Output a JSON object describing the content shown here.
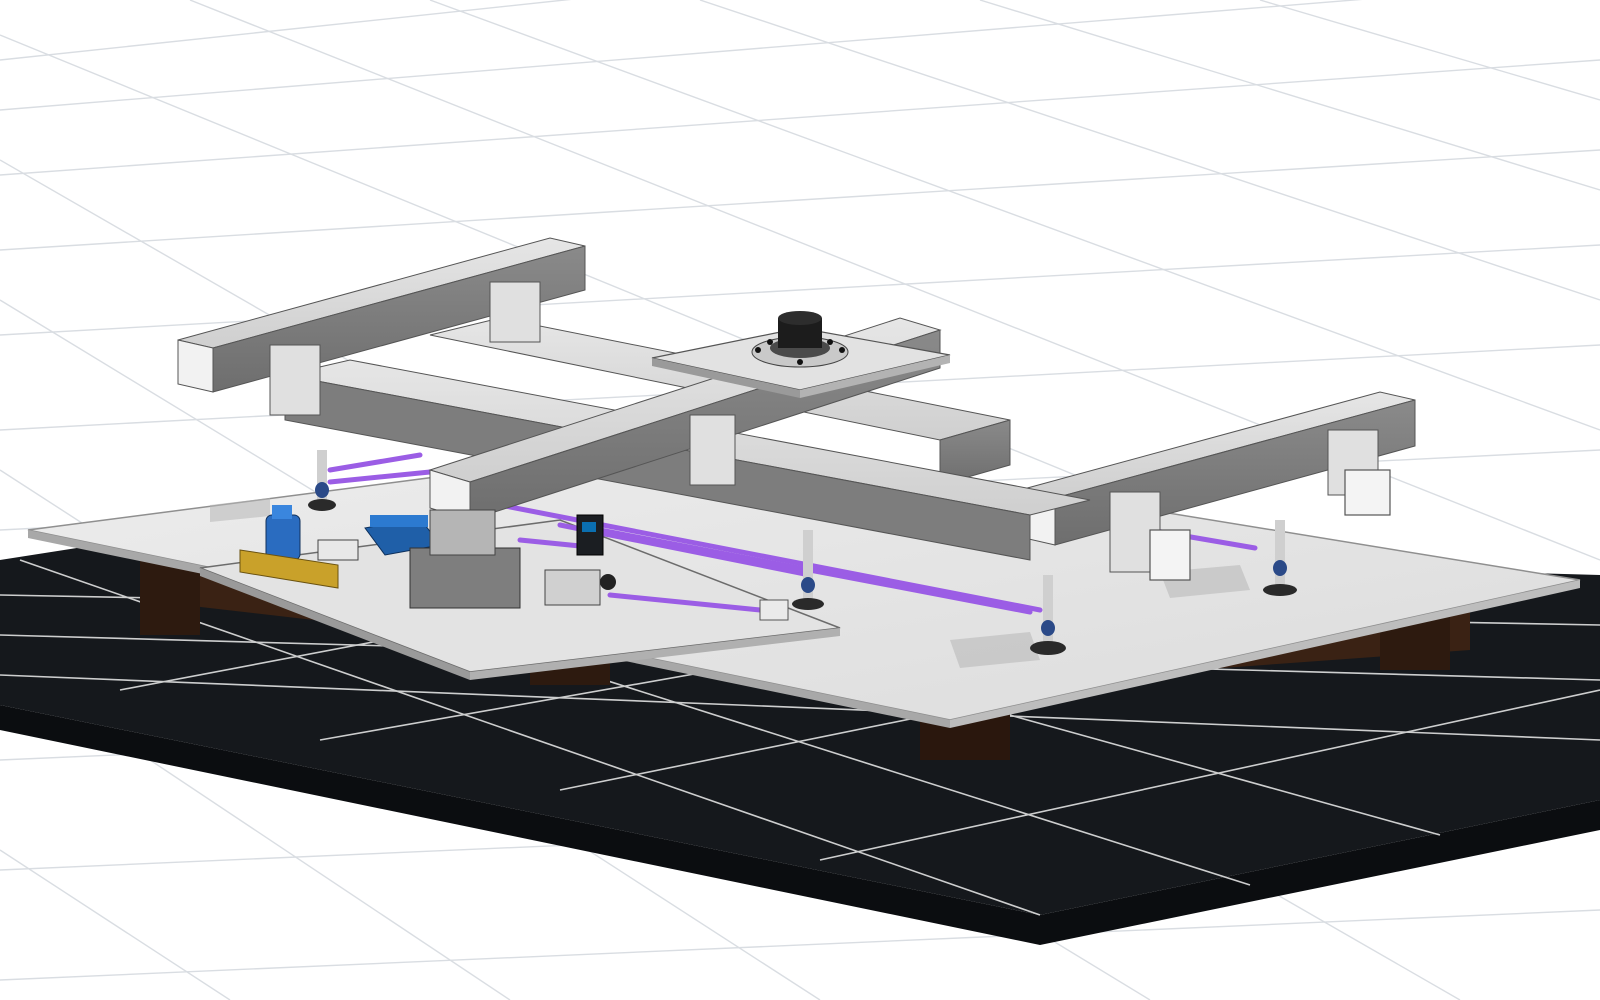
{
  "viewport": {
    "background": "#ffffff",
    "grid_color": "#d9dde2"
  },
  "scene": {
    "table_color": "#15181c",
    "plate_color": "#e9eaeb",
    "pallet_color": "#3a2214",
    "frame_top_color": "#dadada",
    "frame_side_color": "#9b9b9b",
    "hose_color": "#9b5de5",
    "pump_color": "#1f5fa8",
    "label_plate_color": "#c9a12a"
  }
}
